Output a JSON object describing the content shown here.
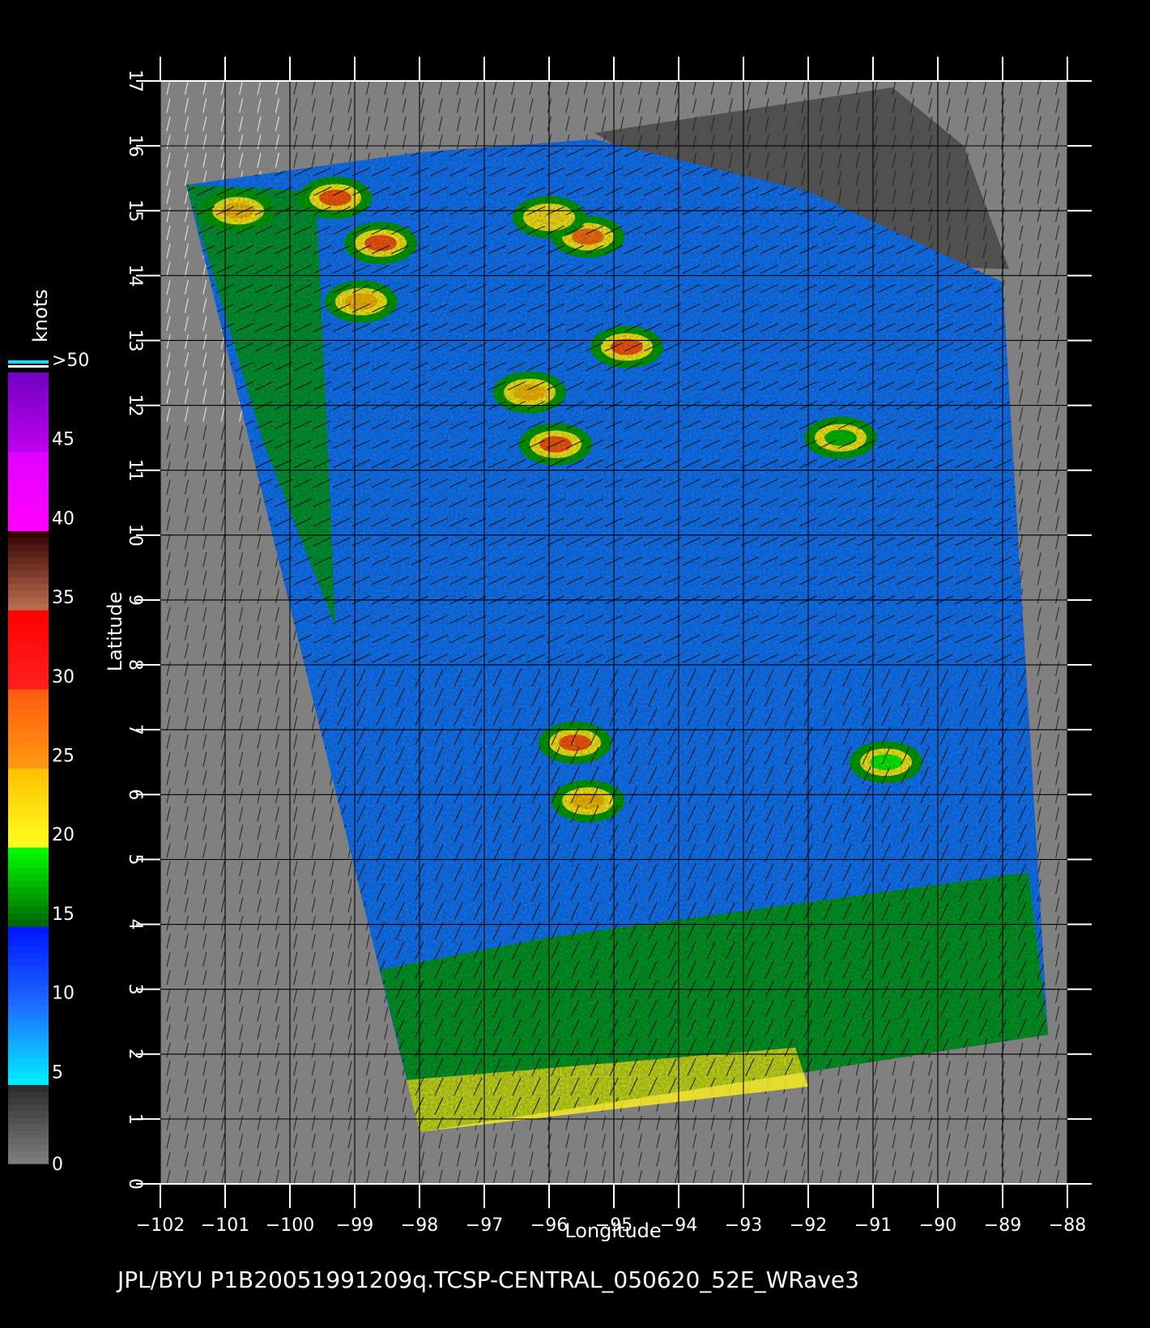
{
  "chart_data": {
    "type": "heatmap",
    "title": "",
    "xlabel": "Longitude",
    "ylabel": "Latitude",
    "xlim": [
      -102,
      -88
    ],
    "ylim": [
      0,
      17
    ],
    "x_ticks": [
      -102,
      -101,
      -100,
      -99,
      -98,
      -97,
      -96,
      -95,
      -94,
      -93,
      -92,
      -91,
      -90,
      -89,
      -88
    ],
    "x_tick_labels": [
      "−102",
      "−101",
      "−100",
      "−99",
      "−98",
      "−97",
      "−96",
      "−95",
      "−94",
      "−93",
      "−92",
      "−91",
      "−90",
      "−89",
      "−88"
    ],
    "y_ticks": [
      0,
      1,
      2,
      3,
      4,
      5,
      6,
      7,
      8,
      9,
      10,
      11,
      12,
      13,
      14,
      15,
      16,
      17
    ],
    "y_tick_labels": [
      "0",
      "1",
      "2",
      "3",
      "4",
      "5",
      "6",
      "7",
      "8",
      "9",
      "10",
      "11",
      "12",
      "13",
      "14",
      "15",
      "16",
      "17"
    ],
    "grid": true,
    "colorbar": {
      "title": "knots",
      "ticks": [
        "0",
        "5",
        "10",
        "15",
        "20",
        "25",
        "30",
        "35",
        "40",
        "45",
        ">50"
      ],
      "range": [
        0,
        50
      ],
      "segments": [
        {
          "from": 0,
          "to": 5,
          "colors": [
            "#808080",
            "#2a2a2a"
          ]
        },
        {
          "from": 5,
          "to": 10,
          "colors": [
            "#00f0ff",
            "#1e6cff"
          ]
        },
        {
          "from": 10,
          "to": 15,
          "colors": [
            "#1e6cff",
            "#0014ff"
          ]
        },
        {
          "from": 15,
          "to": 20,
          "colors": [
            "#006400",
            "#00ff00"
          ]
        },
        {
          "from": 20,
          "to": 25,
          "colors": [
            "#ffff20",
            "#ffc000"
          ]
        },
        {
          "from": 25,
          "to": 30,
          "colors": [
            "#ff9a10",
            "#ff5a10"
          ]
        },
        {
          "from": 30,
          "to": 35,
          "colors": [
            "#ff2020",
            "#ff0000"
          ]
        },
        {
          "from": 35,
          "to": 40,
          "colors": [
            "#c07050",
            "#300000"
          ]
        },
        {
          "from": 40,
          "to": 45,
          "colors": [
            "#ff00ff",
            "#e000ff"
          ]
        },
        {
          "from": 45,
          "to": 50,
          "colors": [
            "#c000f0",
            "#7000c0"
          ]
        }
      ]
    },
    "swath_corners": [
      {
        "lon": -101.6,
        "lat": 15.4
      },
      {
        "lon": -98.0,
        "lat": 15.9
      },
      {
        "lon": -95.3,
        "lat": 16.1
      },
      {
        "lon": -92.0,
        "lat": 15.3
      },
      {
        "lon": -89.0,
        "lat": 13.9
      },
      {
        "lon": -88.3,
        "lat": 2.3
      },
      {
        "lon": -98.0,
        "lat": 0.8
      }
    ],
    "swath_dominant_speed_knots": 12,
    "high_wind_cells": [
      {
        "lon": -98.6,
        "lat": 14.5,
        "speed_knots": 30
      },
      {
        "lon": -98.9,
        "lat": 13.6,
        "speed_knots": 25
      },
      {
        "lon": -95.9,
        "lat": 11.4,
        "speed_knots": 30
      },
      {
        "lon": -96.3,
        "lat": 12.2,
        "speed_knots": 25
      },
      {
        "lon": -95.4,
        "lat": 14.6,
        "speed_knots": 28
      },
      {
        "lon": -94.8,
        "lat": 12.9,
        "speed_knots": 30
      },
      {
        "lon": -96.0,
        "lat": 14.9,
        "speed_knots": 22
      },
      {
        "lon": -95.6,
        "lat": 6.8,
        "speed_knots": 30
      },
      {
        "lon": -95.4,
        "lat": 5.9,
        "speed_knots": 25
      },
      {
        "lon": -91.5,
        "lat": 11.5,
        "speed_knots": 18
      },
      {
        "lon": -90.8,
        "lat": 6.5,
        "speed_knots": 20
      },
      {
        "lon": -99.3,
        "lat": 15.2,
        "speed_knots": 30
      },
      {
        "lon": -100.8,
        "lat": 15.0,
        "speed_knots": 25
      }
    ],
    "background_color": "#808080",
    "land_color": "#505050"
  },
  "footer": {
    "text": "JPL/BYU  P1B20051991209q.TCSP-CENTRAL_050620_52E_WRave3"
  }
}
